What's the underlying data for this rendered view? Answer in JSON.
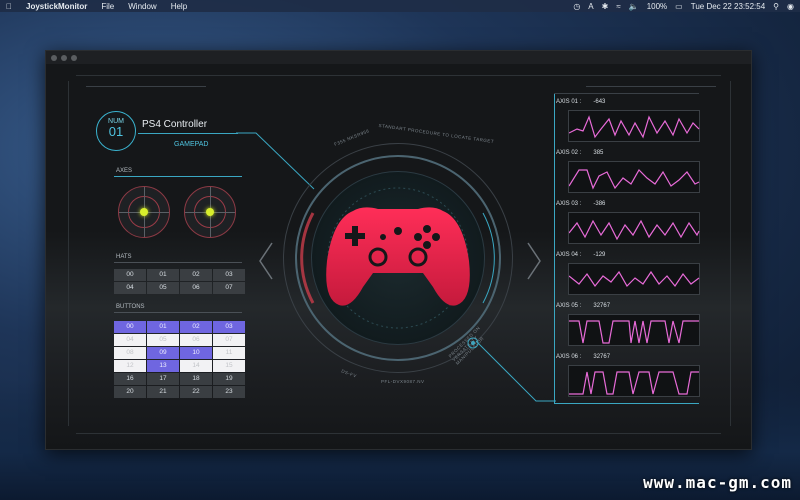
{
  "menubar": {
    "app_name": "JoystickMonitor",
    "items": [
      "File",
      "Window",
      "Help"
    ],
    "battery": "100%",
    "clock": "Tue Dec 22  23:52:54"
  },
  "device": {
    "num_label": "NUM",
    "num_value": "01",
    "name": "PS4 Controller",
    "type": "GAMEPAD"
  },
  "sections": {
    "axes": "AXES",
    "hats": "HATS",
    "buttons": "BUTTONS"
  },
  "hats": [
    "00",
    "01",
    "02",
    "03",
    "04",
    "05",
    "06",
    "07"
  ],
  "buttons": [
    {
      "label": "00",
      "state": "pressed"
    },
    {
      "label": "01",
      "state": "pressed"
    },
    {
      "label": "02",
      "state": "pressed"
    },
    {
      "label": "03",
      "state": "pressed"
    },
    {
      "label": "04",
      "state": "white"
    },
    {
      "label": "05",
      "state": "white"
    },
    {
      "label": "06",
      "state": "white"
    },
    {
      "label": "07",
      "state": "white"
    },
    {
      "label": "08",
      "state": "white"
    },
    {
      "label": "09",
      "state": "pressed"
    },
    {
      "label": "10",
      "state": "pressed"
    },
    {
      "label": "11",
      "state": "white"
    },
    {
      "label": "12",
      "state": "white"
    },
    {
      "label": "13",
      "state": "pressed"
    },
    {
      "label": "14",
      "state": "white"
    },
    {
      "label": "15",
      "state": "white"
    },
    {
      "label": "16",
      "state": "normal"
    },
    {
      "label": "17",
      "state": "normal"
    },
    {
      "label": "18",
      "state": "normal"
    },
    {
      "label": "19",
      "state": "normal"
    },
    {
      "label": "20",
      "state": "normal"
    },
    {
      "label": "21",
      "state": "normal"
    },
    {
      "label": "22",
      "state": "normal"
    },
    {
      "label": "23",
      "state": "normal"
    }
  ],
  "center": {
    "arc_text_top": "STANDART PROCEDURE TO LOCATE TARGET",
    "arc_text_topleft": "F355 NKSR956",
    "arc_text_right": "PROCESSED ON VERSATILITY MANIPULATOR",
    "arc_text_bottom": "PFL-DVX9087.NV",
    "arc_text_bottomleft": "DS-FV"
  },
  "axes_right": [
    {
      "name": "AXIS 01 :",
      "value": "-643"
    },
    {
      "name": "AXIS 02 :",
      "value": "385"
    },
    {
      "name": "AXIS 03 :",
      "value": "-386"
    },
    {
      "name": "AXIS 04 :",
      "value": "-129"
    },
    {
      "name": "AXIS 05 :",
      "value": "32767"
    },
    {
      "name": "AXIS 06 :",
      "value": "32767"
    }
  ],
  "colors": {
    "accent": "#3aa7c2",
    "pressed": "#6f66e0",
    "graph": "#e86bd8",
    "gamepad_top": "#ff2e58",
    "gamepad_bottom": "#c51a3c",
    "stick_dot": "#d8ef2c"
  },
  "watermark": "www.mac-gm.com"
}
